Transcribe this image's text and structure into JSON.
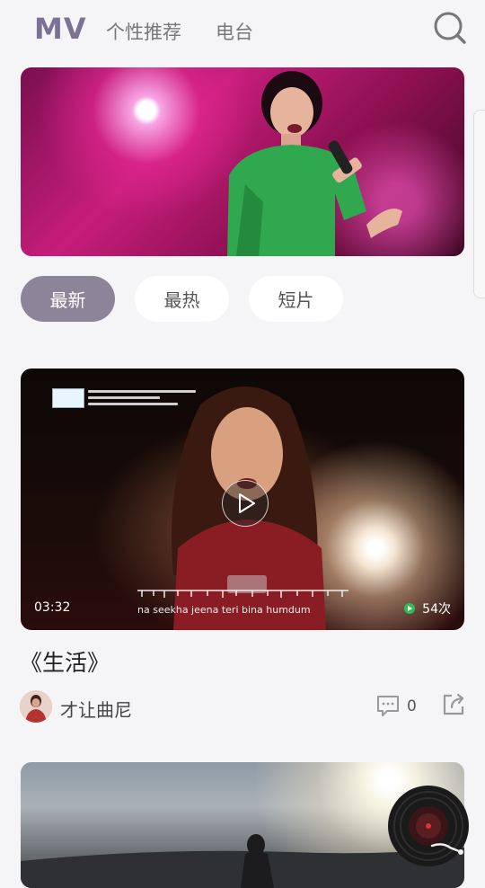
{
  "header": {
    "tabs": [
      {
        "label": "MV"
      },
      {
        "label": "个性推荐"
      },
      {
        "label": "电台"
      }
    ]
  },
  "filters": [
    {
      "label": "最新"
    },
    {
      "label": "最热"
    },
    {
      "label": "短片"
    }
  ],
  "video": {
    "duration": "03:32",
    "views": "54次",
    "title": "《生活》",
    "author": "才让曲尼",
    "comments": "0",
    "subtitle_roman": "na seekha jeena teri bina humdum"
  },
  "colors": {
    "accent": "#7c7394",
    "chip_active": "#8c8499",
    "background": "#f5f5f7",
    "views_dot": "#2ebd59"
  },
  "icons": [
    "search-icon",
    "play-icon",
    "comment-icon",
    "share-icon",
    "vinyl-icon"
  ]
}
